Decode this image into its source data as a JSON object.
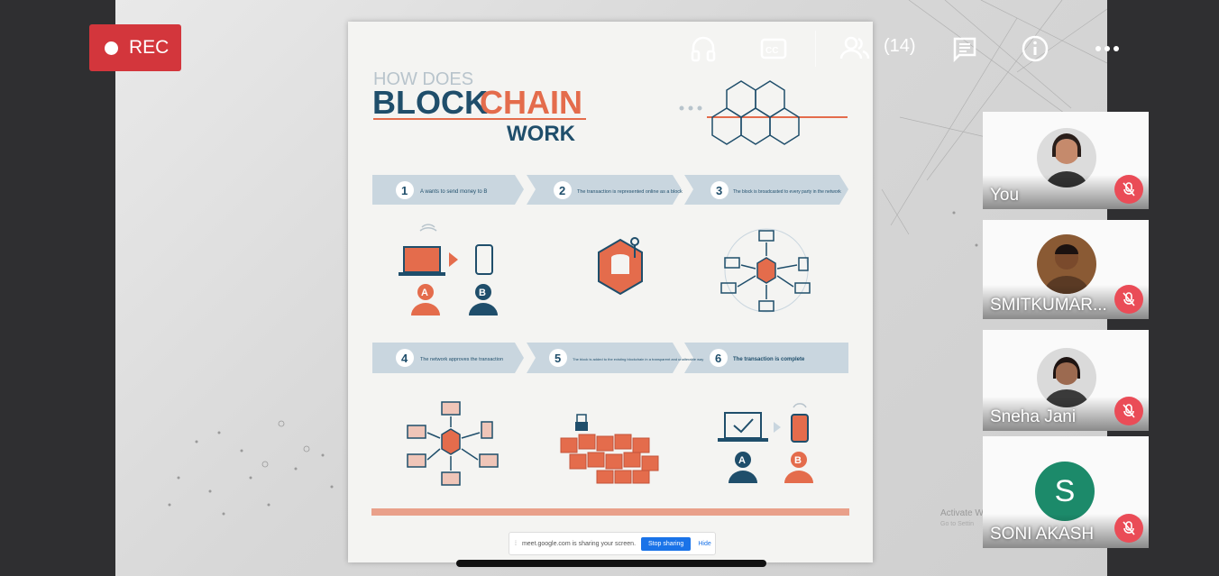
{
  "recording": {
    "label": "REC"
  },
  "toolbar": {
    "participants_count": "(14)",
    "icons": [
      "headphones-icon",
      "captions-icon",
      "people-icon",
      "chat-icon",
      "info-icon",
      "more-icon"
    ]
  },
  "slide": {
    "title_line1": "HOW DOES",
    "title_block": "BLOCK",
    "title_chain": "CHAIN",
    "title_line3": "WORK",
    "steps": [
      {
        "num": "1",
        "text": "A wants to send money to B"
      },
      {
        "num": "2",
        "text": "The transaction is represented online as a block"
      },
      {
        "num": "3",
        "text": "The block is broadcasted to every party in the network"
      },
      {
        "num": "4",
        "text": "The network approves the transaction"
      },
      {
        "num": "5",
        "text": "The block is added to the existing blockchain in a transparent and unalterable way"
      },
      {
        "num": "6",
        "text": "The transaction is complete"
      }
    ],
    "badge_a": "A",
    "badge_b": "B"
  },
  "share": {
    "message": "meet.google.com is sharing your screen.",
    "stop_label": "Stop sharing",
    "hide_label": "Hide"
  },
  "participants": [
    {
      "name": "You"
    },
    {
      "name": "SMITKUMAR..."
    },
    {
      "name": "Sneha Jani"
    },
    {
      "name": "SONI AKASH",
      "initial": "S"
    }
  ],
  "watermark": {
    "line1": "Activate W",
    "line2": "Go to Settin"
  },
  "colors": {
    "rec": "#d3363c",
    "navy": "#1f4e6b",
    "orange": "#e46c4c",
    "mute": "#ea4c57",
    "avatar_s": "#1c8a6a"
  }
}
